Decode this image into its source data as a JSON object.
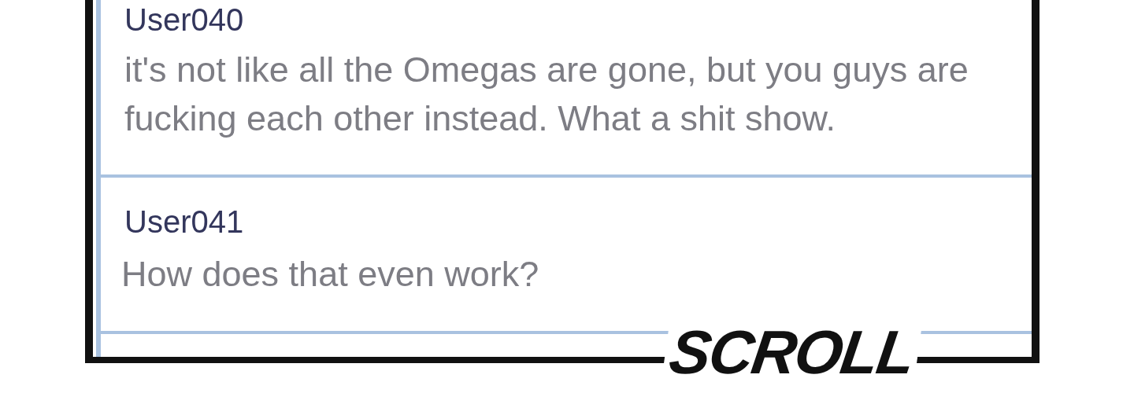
{
  "comments": [
    {
      "username": "User040",
      "text": "it's not like all the Omegas are gone, but you guys are fucking each other instead. What a shit show."
    },
    {
      "username": "User041",
      "text": "How does that even work?"
    }
  ],
  "sound_effect": {
    "text": "SCROLL"
  }
}
